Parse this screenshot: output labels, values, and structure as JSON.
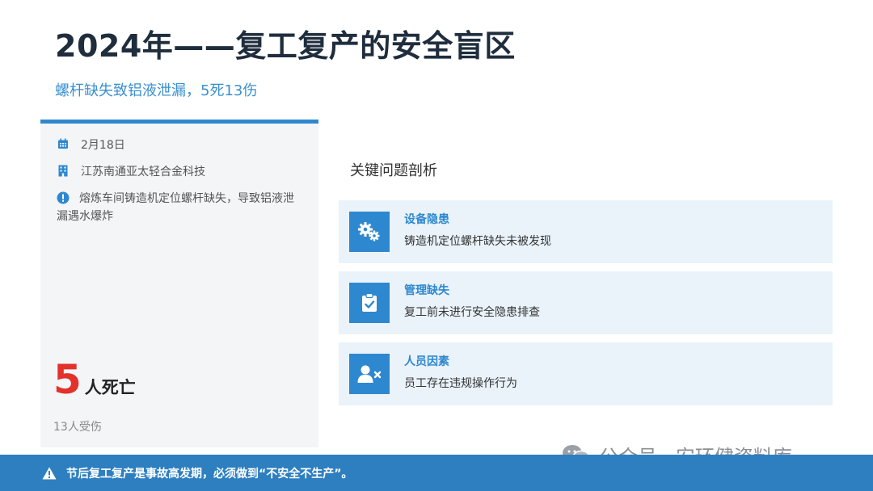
{
  "header": {
    "title": "2024年——复工复产的安全盲区",
    "subtitle": "螺杆缺失致铝液泄漏，5死13伤"
  },
  "incident": {
    "date": "2月18日",
    "company": "江苏南通亚太轻合金科技",
    "description": "熔炼车间铸造机定位螺杆缺失，导致铝液泄漏遇水爆炸",
    "deaths_number": "5",
    "deaths_unit": "人死亡",
    "injured": "13人受伤"
  },
  "analysis": {
    "title": "关键问题剖析",
    "items": [
      {
        "name": "设备隐患",
        "desc": "铸造机定位螺杆缺失未被发现",
        "icon": "gears-icon"
      },
      {
        "name": "管理缺失",
        "desc": "复工前未进行安全隐患排查",
        "icon": "clipboard-check-icon"
      },
      {
        "name": "人员因素",
        "desc": "员工存在违规操作行为",
        "icon": "user-x-icon"
      }
    ]
  },
  "watermark": {
    "text": "公众号 · 安环健资料库"
  },
  "footer": {
    "text": "节后复工复产是事故高发期，必须做到“不安全不生产”。"
  },
  "colors": {
    "accent": "#2e88cf",
    "danger": "#e2322b",
    "footer": "#2e7fc0",
    "card": "#f3f5f7",
    "item": "#eaf3fa"
  }
}
